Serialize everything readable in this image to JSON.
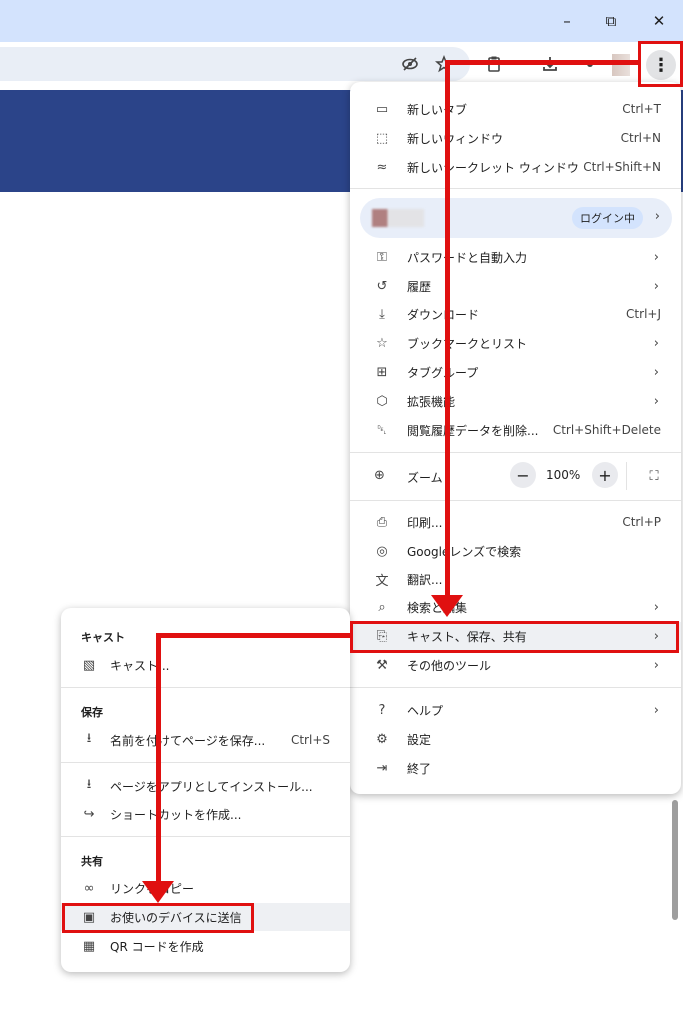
{
  "window_controls": {
    "minimize": "–",
    "restore": "⧉",
    "close": "✕"
  },
  "toolbar": {
    "menu_glyph": "⋮"
  },
  "main_menu": {
    "items_top": [
      {
        "icon": "new-tab-icon",
        "glyph": "▭",
        "label": "新しいタブ",
        "shortcut": "Ctrl+T"
      },
      {
        "icon": "new-window-icon",
        "glyph": "⬚",
        "label": "新しいウィンドウ",
        "shortcut": "Ctrl+N"
      },
      {
        "icon": "incognito-icon",
        "glyph": "≈",
        "label": "新しいシークレット ウィンドウ",
        "shortcut": "Ctrl+Shift+N"
      }
    ],
    "profile": {
      "badge": "ログイン中",
      "arrow": "›"
    },
    "items_mid": [
      {
        "icon": "key-icon",
        "glyph": "⚿",
        "label": "パスワードと自動入力",
        "shortcut": "",
        "arrow": "›"
      },
      {
        "icon": "history-icon",
        "glyph": "↺",
        "label": "履歴",
        "shortcut": "",
        "arrow": "›"
      },
      {
        "icon": "download-icon",
        "glyph": "⤓",
        "label": "ダウンロード",
        "shortcut": "Ctrl+J",
        "arrow": ""
      },
      {
        "icon": "star-icon",
        "glyph": "☆",
        "label": "ブックマークとリスト",
        "shortcut": "",
        "arrow": "›"
      },
      {
        "icon": "tab-groups-icon",
        "glyph": "⊞",
        "label": "タブグループ",
        "shortcut": "",
        "arrow": "›"
      },
      {
        "icon": "extensions-icon",
        "glyph": "⬡",
        "label": "拡張機能",
        "shortcut": "",
        "arrow": "›"
      },
      {
        "icon": "trash-icon",
        "glyph": "␡",
        "label": "閲覧履歴データを削除...",
        "shortcut": "Ctrl+Shift+Delete",
        "arrow": ""
      }
    ],
    "zoom": {
      "label": "ズーム",
      "minus": "−",
      "value": "100%",
      "plus": "+",
      "fullscreen_glyph": "⛶"
    },
    "items_tools": [
      {
        "icon": "print-icon",
        "glyph": "⎙",
        "label": "印刷...",
        "shortcut": "Ctrl+P",
        "arrow": ""
      },
      {
        "icon": "google-lens-icon",
        "glyph": "◎",
        "label": "Googleレンズで検索",
        "shortcut": "",
        "arrow": ""
      },
      {
        "icon": "translate-icon",
        "glyph": "文",
        "label": "翻訳...",
        "shortcut": "",
        "arrow": ""
      },
      {
        "icon": "find-icon",
        "glyph": "⌕",
        "label": "検索と編集",
        "shortcut": "",
        "arrow": "›"
      },
      {
        "icon": "cast-save-share-icon",
        "glyph": "⎘",
        "label": "キャスト、保存、共有",
        "shortcut": "",
        "arrow": "›"
      },
      {
        "icon": "toolbox-icon",
        "glyph": "⚒",
        "label": "その他のツール",
        "shortcut": "",
        "arrow": "›"
      }
    ],
    "items_bottom": [
      {
        "icon": "help-icon",
        "glyph": "?",
        "label": "ヘルプ",
        "shortcut": "",
        "arrow": "›"
      },
      {
        "icon": "settings-icon",
        "glyph": "⚙",
        "label": "設定",
        "shortcut": "",
        "arrow": ""
      },
      {
        "icon": "exit-icon",
        "glyph": "⇥",
        "label": "終了",
        "shortcut": "",
        "arrow": ""
      }
    ]
  },
  "sub_menu": {
    "cast_header": "キャスト",
    "cast_item": {
      "icon": "cast-icon",
      "glyph": "▧",
      "label": "キャスト..."
    },
    "save_header": "保存",
    "save_item": {
      "icon": "save-page-icon",
      "glyph": "⭳",
      "label": "名前を付けてページを保存...",
      "shortcut": "Ctrl+S"
    },
    "install_item": {
      "icon": "install-app-icon",
      "glyph": "⭳",
      "label": "ページをアプリとしてインストール..."
    },
    "shortcut_item": {
      "icon": "shortcut-icon",
      "glyph": "↪",
      "label": "ショートカットを作成..."
    },
    "share_header": "共有",
    "copy_link_item": {
      "icon": "link-icon",
      "glyph": "∞",
      "label": "リンクをコピー"
    },
    "send_device_item": {
      "icon": "send-to-device-icon",
      "glyph": "▣",
      "label": "お使いのデバイスに送信"
    },
    "qr_item": {
      "icon": "qr-code-icon",
      "glyph": "▦",
      "label": "QR コードを作成"
    }
  },
  "accent_colors": {
    "annotation": "#e01010",
    "banner": "#2b4489",
    "titlebar": "#d3e3fd"
  }
}
